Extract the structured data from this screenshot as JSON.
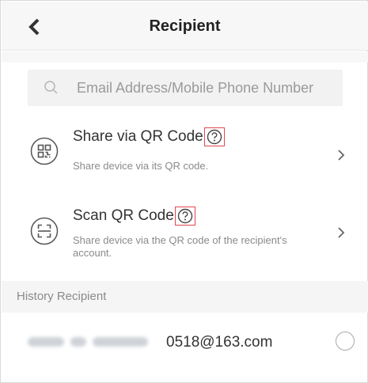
{
  "header": {
    "title": "Recipient"
  },
  "search": {
    "placeholder": "Email Address/Mobile Phone Number"
  },
  "options": [
    {
      "title": "Share via QR Code",
      "subtitle": "Share device via its QR code.",
      "icon": "qr-code-icon"
    },
    {
      "title": "Scan QR Code",
      "subtitle": "Share device via the QR code of the recipient's account.",
      "icon": "scan-icon"
    }
  ],
  "history": {
    "section_label": "History Recipient",
    "items": [
      {
        "email_visible": "0518@163.com"
      }
    ]
  },
  "colors": {
    "highlight": "#e0484f",
    "text": "#333333",
    "muted": "#8a8a8a"
  }
}
